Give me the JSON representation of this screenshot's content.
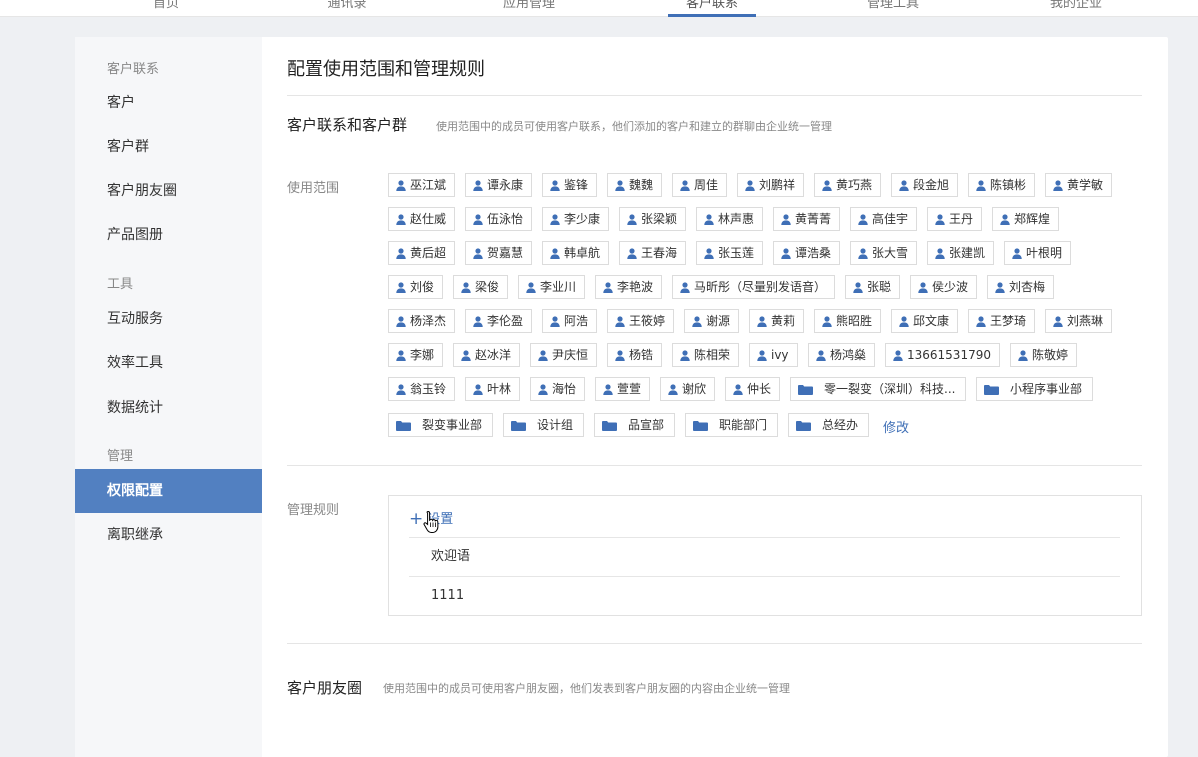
{
  "nav": {
    "tabs": [
      {
        "label": "首页"
      },
      {
        "label": "通讯录"
      },
      {
        "label": "应用管理"
      },
      {
        "label": "客户联系"
      },
      {
        "label": "管理工具"
      },
      {
        "label": "我的企业"
      }
    ],
    "active_tab": "客户联系"
  },
  "sidebar": {
    "groups": [
      {
        "label": "客户联系",
        "items": [
          {
            "label": "客户"
          },
          {
            "label": "客户群"
          },
          {
            "label": "客户朋友圈"
          },
          {
            "label": "产品图册"
          }
        ]
      },
      {
        "label": "工具",
        "items": [
          {
            "label": "互动服务"
          },
          {
            "label": "效率工具"
          },
          {
            "label": "数据统计"
          }
        ]
      },
      {
        "label": "管理",
        "items": [
          {
            "label": "权限配置"
          },
          {
            "label": "离职继承"
          }
        ]
      }
    ],
    "active_item": "权限配置"
  },
  "main": {
    "title": "配置使用范围和管理规则",
    "section1": {
      "title": "客户联系和客户群",
      "desc": "使用范围中的成员可使用客户联系，他们添加的客户和建立的群聊由企业统一管理",
      "scope_label": "使用范围",
      "rows": [
        [
          "巫江斌",
          "谭永康",
          "鉴锋",
          "魏魏",
          "周佳",
          "刘鹏祥",
          "黄巧燕",
          "段金旭",
          "陈镇彬",
          "黄学敏"
        ],
        [
          "赵仕威",
          "伍泳怡",
          "李少康",
          "张梁颖",
          "林声惠",
          "黄菁菁",
          "高佳宇",
          "王丹",
          "郑辉煌"
        ],
        [
          "黄后超",
          "贺嘉慧",
          "韩卓航",
          "王春海",
          "张玉莲",
          "谭浩桑",
          "张大雪",
          "张建凯",
          "叶根明"
        ],
        [
          "刘俊",
          "梁俊",
          "李业川",
          "李艳波",
          "马昕彤（尽量别发语音）",
          "张聪",
          "侯少波",
          "刘杏梅"
        ],
        [
          "杨泽杰",
          "李伦盈",
          "阿浩",
          "王筱婷",
          "谢源",
          "黄莉",
          "熊昭胜",
          "邱文康",
          "王梦琦",
          "刘燕琳"
        ],
        [
          "李娜",
          "赵冰洋",
          "尹庆恒",
          "杨锆",
          "陈相荣",
          "ivy",
          "杨鸿燊",
          "13661531790",
          "陈敬婷"
        ],
        [
          "翁玉铃",
          "叶林",
          "海怡",
          "萱萱",
          "谢欣",
          "仲长"
        ]
      ],
      "row7_depts": [
        "零一裂变（深圳）科技...",
        "小程序事业部"
      ],
      "row8_depts": [
        "裂变事业部",
        "设计组",
        "品宣部",
        "职能部门",
        "总经办"
      ],
      "modify_label": "修改"
    },
    "rules": {
      "label": "管理规则",
      "add_label": "设置",
      "items": [
        "欢迎语",
        "1111"
      ]
    },
    "section2": {
      "title": "客户朋友圈",
      "desc": "使用范围中的成员可使用客户朋友圈，他们发表到客户朋友圈的内容由企业统一管理"
    }
  },
  "colors": {
    "accent": "#3f6fb6",
    "sidebar_active": "#5280c1"
  }
}
